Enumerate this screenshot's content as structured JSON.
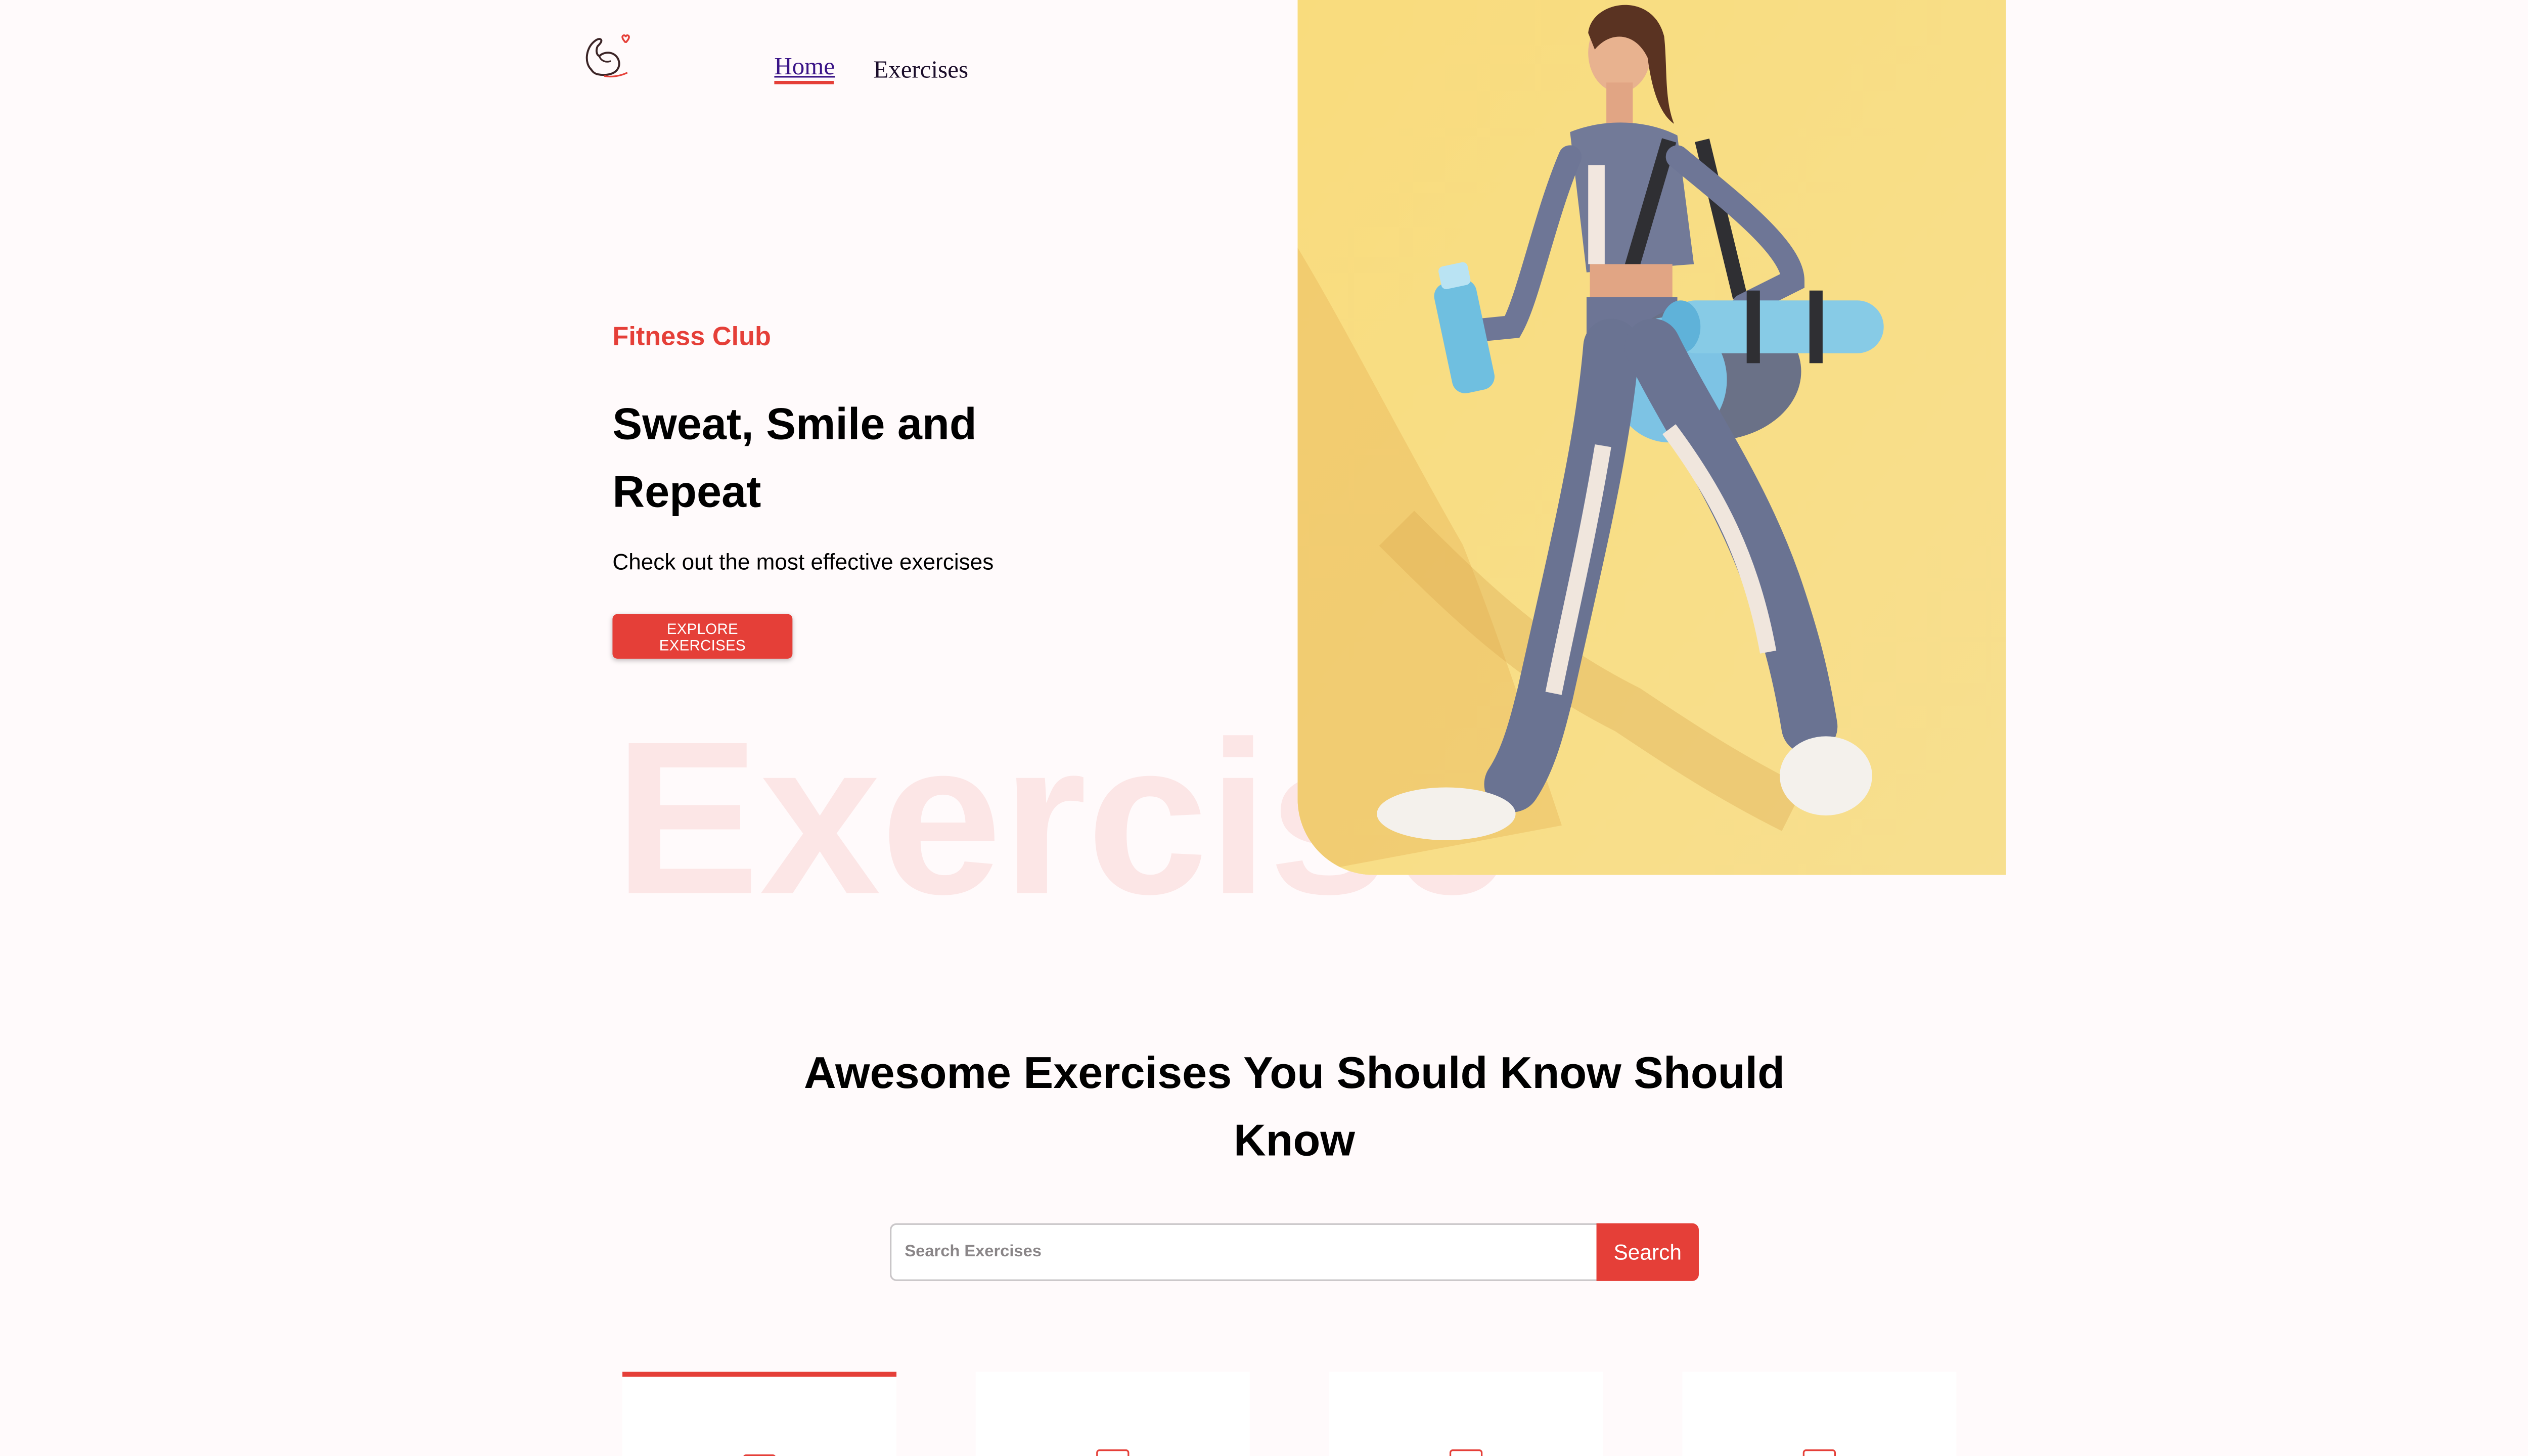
{
  "nav": {
    "logo_icon": "flexed-arm-heart-icon",
    "links": [
      {
        "label": "Home",
        "active": true
      },
      {
        "label": "Exercises",
        "active": false
      }
    ]
  },
  "hero": {
    "tagline": "Fitness Club",
    "title": "Sweat, Smile and Repeat",
    "subtitle": "Check out the most effective exercises",
    "cta_label": "Explore Exercises",
    "background_word": "Exercise",
    "image_alt": "Woman in sportswear walking with water bottle and gym bag with yoga mat"
  },
  "section": {
    "title": "Awesome Exercises You Should Know Should Know"
  },
  "search": {
    "placeholder": "Search Exercises",
    "value": "",
    "button_label": "Search"
  },
  "categories": [
    {
      "icon": "gym-icon",
      "active": true
    },
    {
      "icon": "gym-icon",
      "active": false
    },
    {
      "icon": "gym-icon",
      "active": false
    },
    {
      "icon": "gym-icon",
      "active": false
    }
  ],
  "colors": {
    "accent": "#e53f38",
    "background": "#fffafb",
    "hero_image_bg": "#f6d874"
  }
}
